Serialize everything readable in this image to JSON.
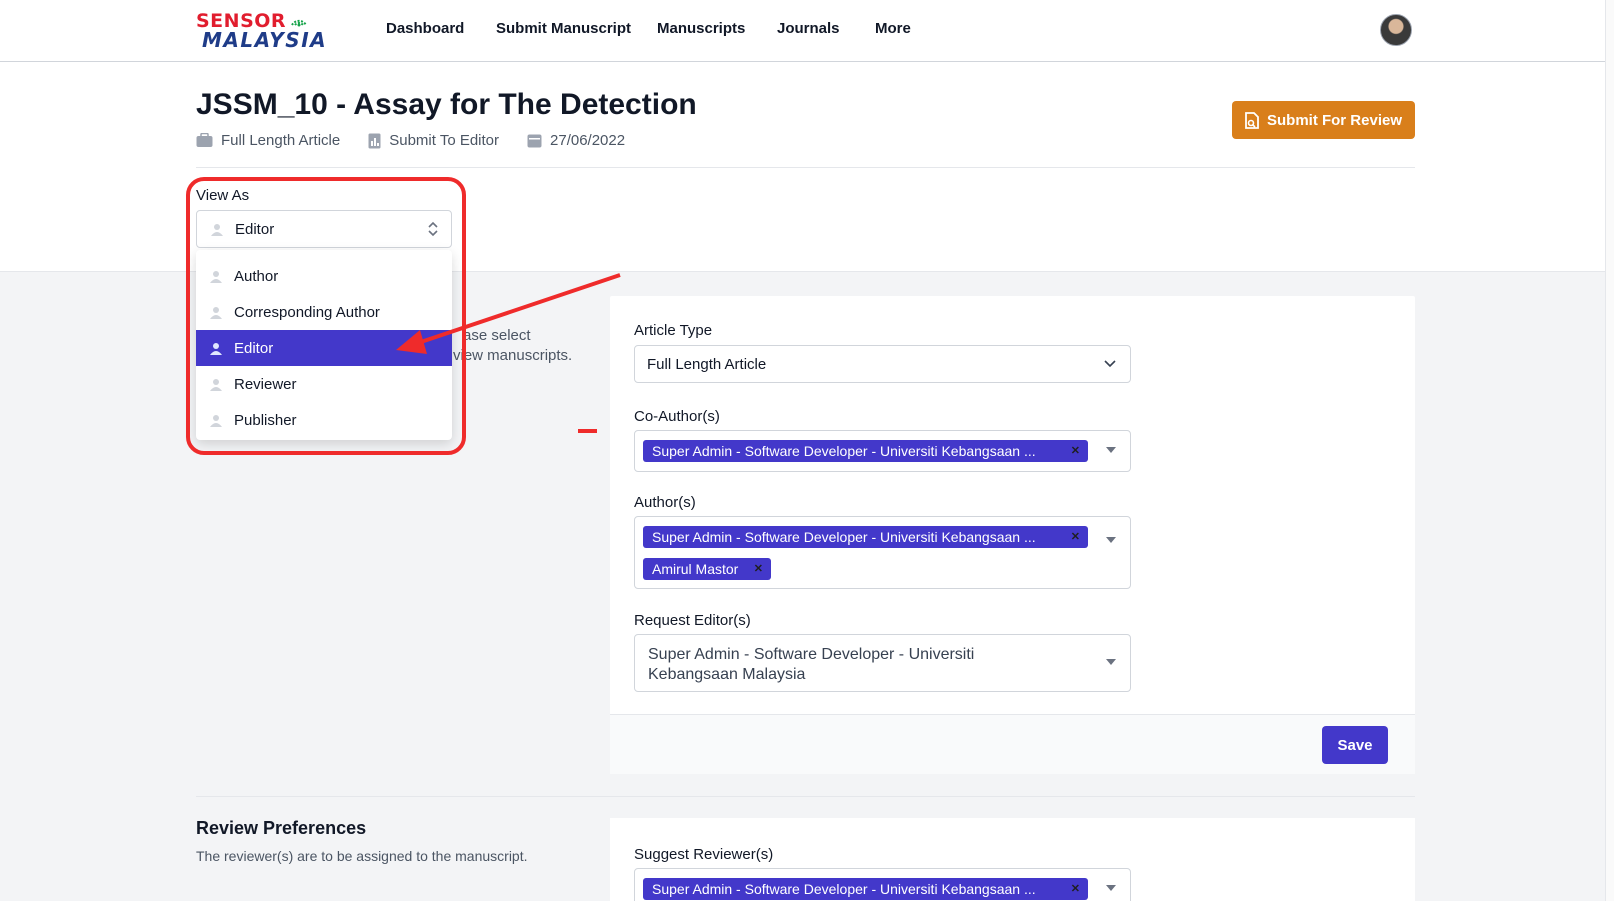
{
  "logo": {
    "line1": "SENSOR",
    "line2": "MALAYSIA"
  },
  "nav": {
    "items": [
      "Dashboard",
      "Submit Manuscript",
      "Manuscripts",
      "Journals",
      "More"
    ]
  },
  "header": {
    "title": "JSSM_10 - Assay for The Detection",
    "article_type": "Full Length Article",
    "status": "Submit To Editor",
    "date": "27/06/2022",
    "submit_button": "Submit For Review"
  },
  "view_as": {
    "label": "View As",
    "selected": "Editor",
    "options": [
      "Author",
      "Corresponding Author",
      "Editor",
      "Reviewer",
      "Publisher"
    ]
  },
  "partial_text": {
    "line1": "ase select",
    "line2": "view manuscripts."
  },
  "form": {
    "article_type_label": "Article Type",
    "article_type_value": "Full Length Article",
    "coauthors_label": "Co-Author(s)",
    "coauthors": [
      "Super Admin - Software Developer - Universiti Kebangsaan ..."
    ],
    "authors_label": "Author(s)",
    "authors": [
      "Super Admin - Software Developer - Universiti Kebangsaan ...",
      "Amirul Mastor"
    ],
    "request_editor_label": "Request Editor(s)",
    "request_editor_value": "Super Admin - Software Developer - Universiti Kebangsaan Malaysia",
    "save_label": "Save"
  },
  "review_prefs": {
    "title": "Review Preferences",
    "description": "The reviewer(s) are to be assigned to the manuscript.",
    "suggest_label": "Suggest Reviewer(s)",
    "suggested": [
      "Super Admin - Software Developer - Universiti Kebangsaan ..."
    ]
  },
  "colors": {
    "primary": "#4338ca",
    "accent": "#d97f1b",
    "annotation": "#ef2b2b"
  }
}
